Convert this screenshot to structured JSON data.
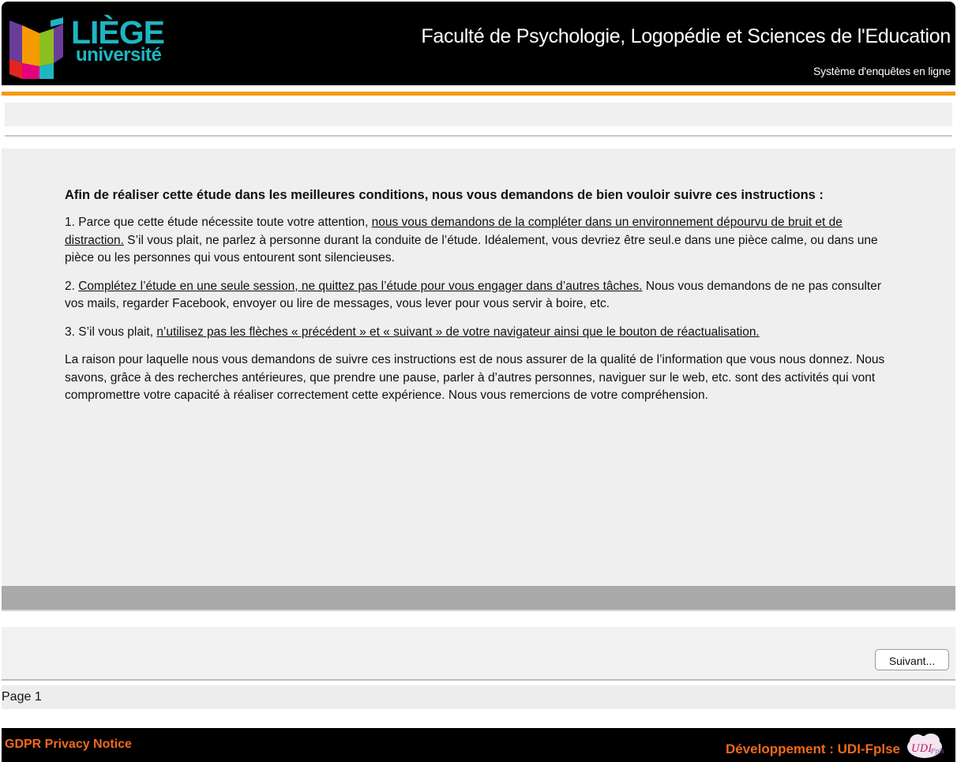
{
  "header": {
    "logo": {
      "line1": "LIÈGE",
      "line2": "université",
      "colors": [
        "#e5007e",
        "#f59a00",
        "#8bbf1e",
        "#1fb5c2",
        "#6a3d9a",
        "#e52421"
      ]
    },
    "faculty": "Faculté de Psychologie, Logopédie et Sciences de l'Education",
    "subtitle": "Système d'enquêtes en ligne"
  },
  "colors": {
    "accent_rule": "#f59a00",
    "footer_link": "#f06a1a"
  },
  "instructions": {
    "intro": "Afin de réaliser cette étude dans les meilleures conditions, nous vous demandons de bien vouloir suivre ces instructions :",
    "item1": {
      "prefix": "1. Parce que cette étude nécessite toute votre attention, ",
      "underlined": "nous vous demandons de la compléter dans un environnement dépourvu de bruit et de distraction.",
      "suffix": " S’il vous plait, ne parlez à personne durant la conduite de l’étude. Idéalement, vous devriez être seul.e dans une pièce calme, ou dans une pièce ou les personnes qui vous entourent sont silencieuses."
    },
    "item2": {
      "prefix": "2. ",
      "underlined": "Complétez l’étude en une seule session, ne quittez pas l’étude pour vous engager dans d’autres tâches.",
      "suffix": " Nous vous demandons de ne pas consulter vos mails, regarder Facebook, envoyer ou lire de messages, vous lever pour vous servir à boire, etc."
    },
    "item3": {
      "prefix": "3. S’il vous plait, ",
      "underlined": "n’utilisez pas les flèches « précédent » et « suivant » de votre navigateur ainsi que le bouton de réactualisation."
    },
    "closing": "La raison pour laquelle nous vous demandons de suivre ces instructions est de nous assurer de la qualité de l’information que vous nous donnez. Nous savons, grâce à des recherches antérieures, que prendre une pause, parler à d’autres personnes, naviguer sur le web, etc. sont des activités qui vont compromettre votre capacité à réaliser correctement cette expérience. Nous vous remercions de votre compréhension."
  },
  "navigation": {
    "next_label": "Suivant...",
    "page_label": "Page 1"
  },
  "footer": {
    "gdpr_label": "GDPR Privacy Notice",
    "dev_label": "Développement : UDI-Fplse",
    "dev_logo_text": "UDI-Fplse"
  }
}
